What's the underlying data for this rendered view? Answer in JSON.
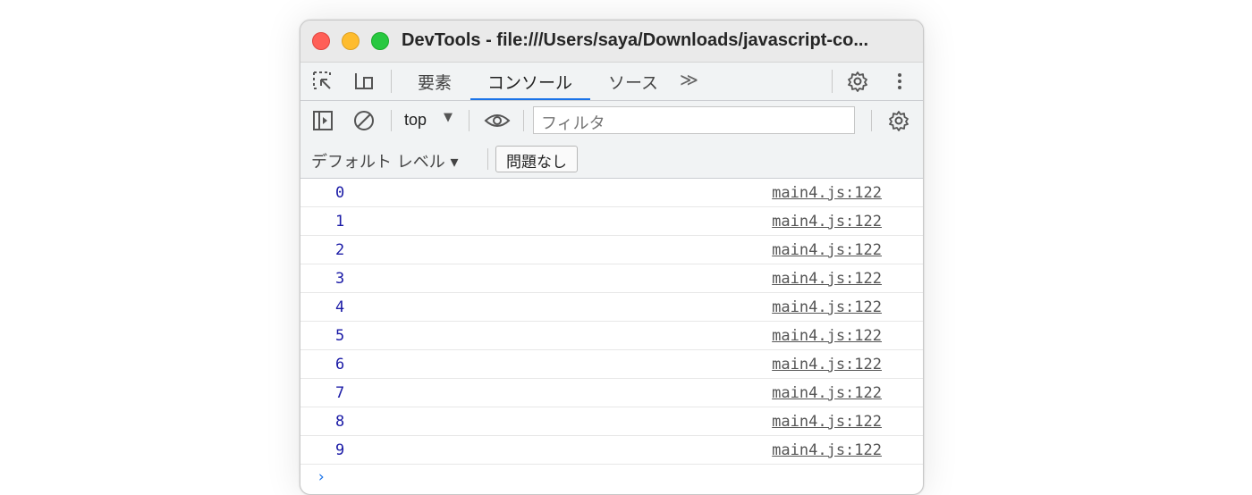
{
  "window": {
    "title": "DevTools - file:///Users/saya/Downloads/javascript-co..."
  },
  "tabs": {
    "elements": "要素",
    "console": "コンソール",
    "sources": "ソース",
    "more": "≫"
  },
  "toolbar": {
    "context": "top",
    "context_arrow": "▼",
    "filter_placeholder": "フィルタ"
  },
  "levelbar": {
    "levels_label": "デフォルト レベル ▾",
    "issues_label": "問題なし"
  },
  "console": {
    "messages": [
      {
        "value": "0",
        "source": "main4.js:122"
      },
      {
        "value": "1",
        "source": "main4.js:122"
      },
      {
        "value": "2",
        "source": "main4.js:122"
      },
      {
        "value": "3",
        "source": "main4.js:122"
      },
      {
        "value": "4",
        "source": "main4.js:122"
      },
      {
        "value": "5",
        "source": "main4.js:122"
      },
      {
        "value": "6",
        "source": "main4.js:122"
      },
      {
        "value": "7",
        "source": "main4.js:122"
      },
      {
        "value": "8",
        "source": "main4.js:122"
      },
      {
        "value": "9",
        "source": "main4.js:122"
      }
    ],
    "prompt": "›"
  },
  "icons": [
    "inspect-element-icon",
    "device-toolbar-icon",
    "settings-icon",
    "more-options-icon",
    "sidebar-toggle-icon",
    "clear-console-icon",
    "live-expression-eye-icon",
    "console-settings-icon"
  ],
  "colors": {
    "accent": "#1a73e8",
    "close": "#ff5f57",
    "minimize": "#febc2e",
    "zoom": "#28c840",
    "log_value": "#1a1aa6"
  }
}
